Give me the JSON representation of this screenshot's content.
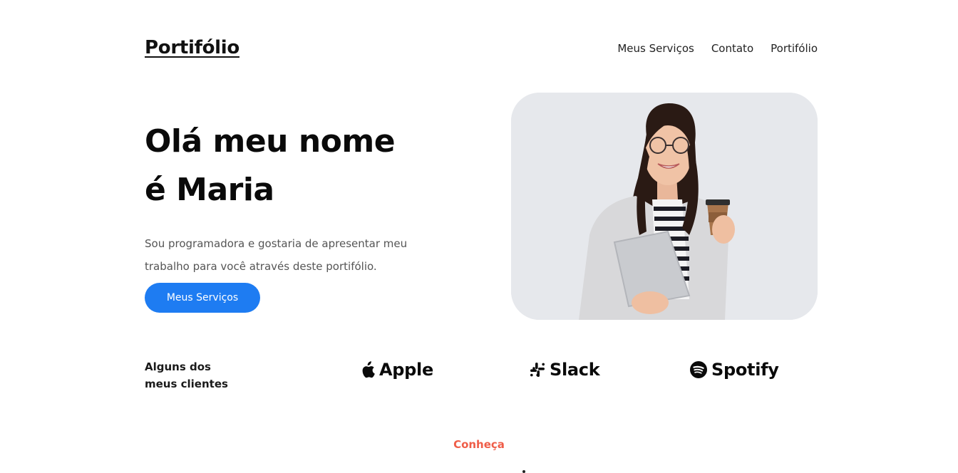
{
  "header": {
    "logo": "Portifólio",
    "nav": [
      "Meus Serviços",
      "Contato",
      "Portifólio"
    ]
  },
  "hero": {
    "title_line1": "Olá meu nome",
    "title_line2": "é Maria",
    "description": "Sou programadora e gostaria de apresentar meu trabalho para você através deste portifólio.",
    "cta_label": "Meus Serviços"
  },
  "clients": {
    "label_line1": "Alguns dos",
    "label_line2": "meus clientes",
    "items": [
      {
        "name": "Apple",
        "icon": "apple-icon"
      },
      {
        "name": "Slack",
        "icon": "slack-icon"
      },
      {
        "name": "Spotify",
        "icon": "spotify-icon"
      }
    ]
  },
  "next_section": {
    "eyebrow": "Conheça"
  },
  "colors": {
    "accent": "#1e7cf2",
    "eyebrow": "#ef5d48",
    "text": "#0a0a0a",
    "muted": "#555555"
  }
}
